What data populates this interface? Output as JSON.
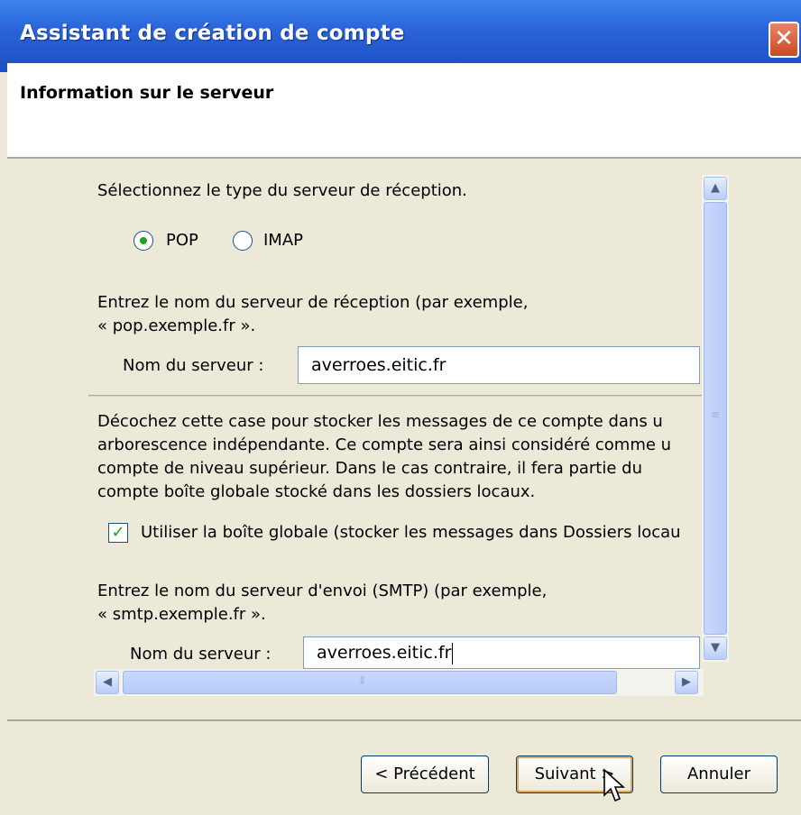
{
  "window": {
    "title": "Assistant de création de compte"
  },
  "header": {
    "title": "Information sur le serveur"
  },
  "incoming_type": {
    "prompt": "Sélectionnez le type du serveur de réception.",
    "options": [
      "POP",
      "IMAP"
    ],
    "selected": "POP"
  },
  "incoming_server": {
    "prompt_line1": "Entrez le nom du serveur de réception (par exemple,",
    "prompt_line2": "« pop.exemple.fr ».",
    "label": "Nom du serveur :",
    "value": "averroes.eitic.fr"
  },
  "global_inbox": {
    "desc_line1": "Décochez cette case pour stocker les messages de ce compte dans u",
    "desc_line2": "arborescence indépendante. Ce compte sera ainsi considéré comme u",
    "desc_line3": "compte de niveau supérieur. Dans le cas contraire, il fera partie du",
    "desc_line4": "compte boîte globale stocké dans les dossiers locaux.",
    "checkbox_label": "Utiliser la boîte globale (stocker les messages dans Dossiers locau",
    "checked": true
  },
  "outgoing_server": {
    "prompt_line1": "Entrez le nom du serveur d'envoi (SMTP) (par exemple,",
    "prompt_line2": "« smtp.exemple.fr ».",
    "label": "Nom du serveur :",
    "value": "averroes.eitic.fr"
  },
  "buttons": {
    "back": "< Précédent",
    "next": "Suivant >",
    "cancel": "Annuler"
  },
  "colors": {
    "titlebar": "#2a64d8",
    "close": "#c94a24",
    "window_bg": "#ece9d8"
  }
}
